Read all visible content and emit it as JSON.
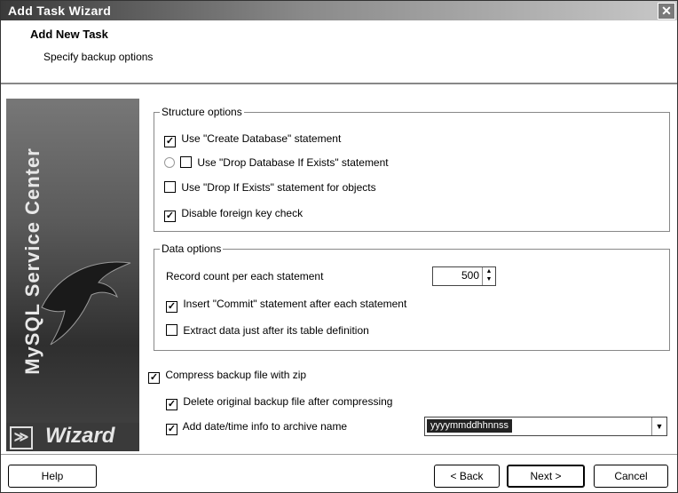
{
  "window": {
    "title": "Add Task Wizard",
    "close_glyph": "✕"
  },
  "header": {
    "title": "Add New Task",
    "subtitle": "Specify backup options"
  },
  "sidebar": {
    "brand": "MySQL Service Center",
    "wizard_label": "Wizard",
    "wizard_glyph": "≫"
  },
  "structure": {
    "legend": "Structure options",
    "create_db": {
      "label": "Use \"Create Database\" statement",
      "checked": true
    },
    "drop_db": {
      "label": "Use \"Drop Database If Exists\" statement",
      "checked": false
    },
    "drop_objects": {
      "label": "Use \"Drop If Exists\" statement for objects",
      "checked": false
    },
    "disable_fk": {
      "label": "Disable foreign key check",
      "checked": true
    }
  },
  "data_opts": {
    "legend": "Data options",
    "record_count_label": "Record count per each statement",
    "record_count_value": "500",
    "insert_commit": {
      "label": "Insert \"Commit\" statement after each statement",
      "checked": true
    },
    "extract_after": {
      "label": "Extract data just after its table definition",
      "checked": false
    }
  },
  "compress": {
    "label": "Compress backup file with zip",
    "checked": true
  },
  "delete_original": {
    "label": "Delete original backup file after compressing",
    "checked": true
  },
  "add_datetime": {
    "label": "Add date/time info to archive name",
    "checked": true,
    "format_value": "yyyymmddhhnnss"
  },
  "buttons": {
    "help": "Help",
    "back": "< Back",
    "next": "Next >",
    "cancel": "Cancel"
  },
  "glyphs": {
    "check": "✓",
    "spin_up": "▲",
    "spin_down": "▼",
    "dropdown": "▼"
  }
}
